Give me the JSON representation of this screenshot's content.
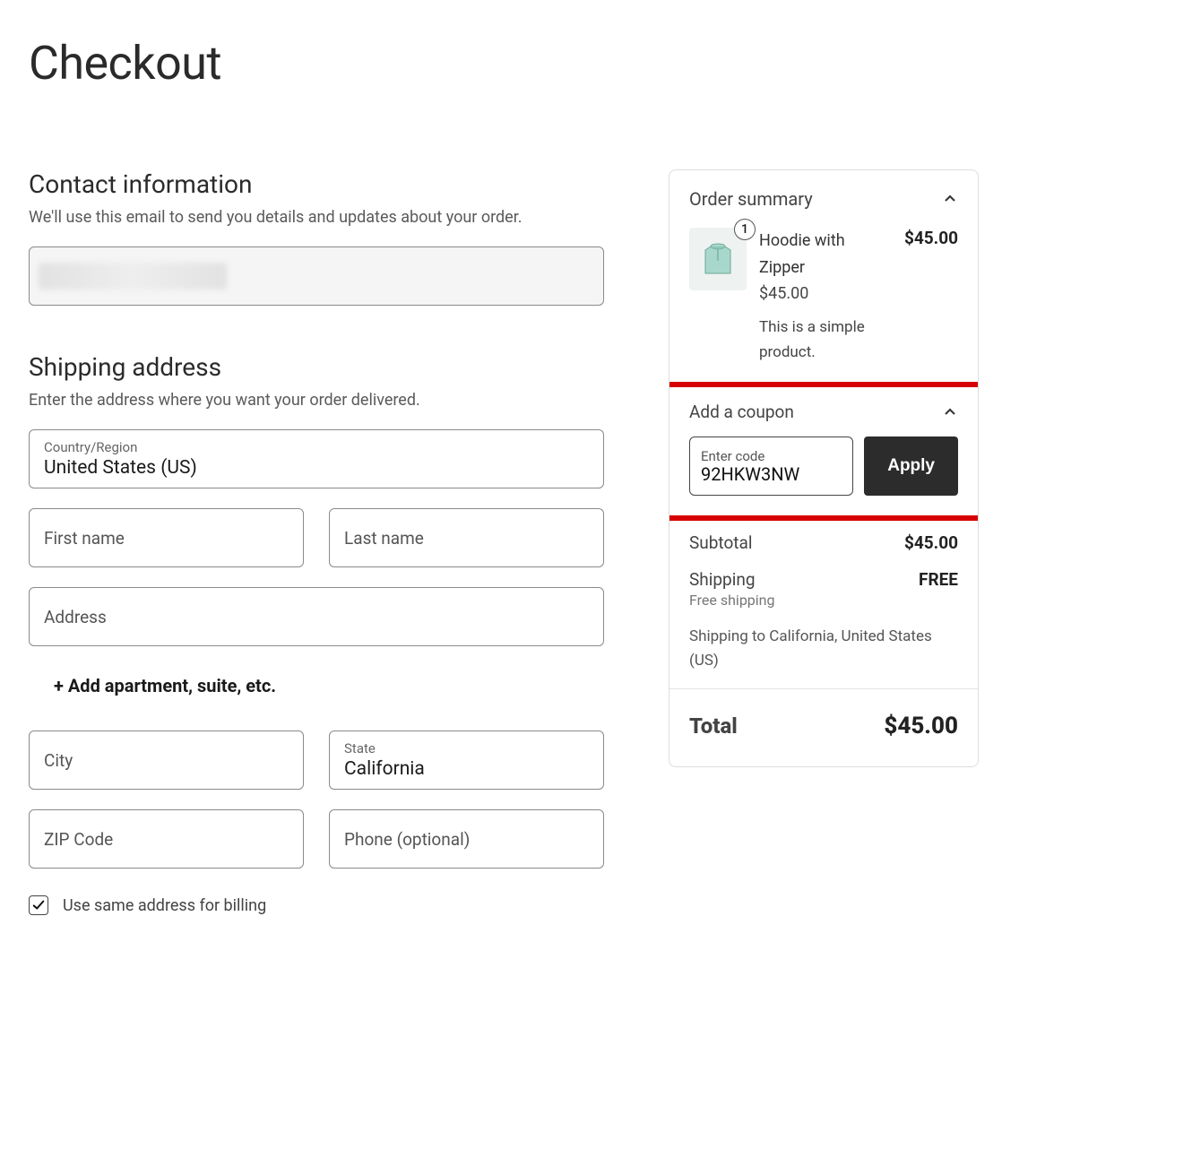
{
  "page_title": "Checkout",
  "contact": {
    "title": "Contact information",
    "desc": "We'll use this email to send you details and updates about your order.",
    "email_value": ""
  },
  "shipping": {
    "title": "Shipping address",
    "desc": "Enter the address where you want your order delivered.",
    "country_label": "Country/Region",
    "country_value": "United States (US)",
    "first_name_label": "First name",
    "last_name_label": "Last name",
    "address_label": "Address",
    "add_apartment": "+ Add apartment, suite, etc.",
    "city_label": "City",
    "state_label": "State",
    "state_value": "California",
    "zip_label": "ZIP Code",
    "phone_label": "Phone (optional)",
    "same_billing_label": "Use same address for billing",
    "same_billing_checked": true
  },
  "summary": {
    "title": "Order summary",
    "product": {
      "name": "Hoodie with Zipper",
      "qty": "1",
      "unit_price": "$45.00",
      "line_price": "$45.00",
      "desc": "This is a simple product."
    },
    "coupon": {
      "title": "Add a coupon",
      "input_label": "Enter code",
      "input_value": "92HKW3NW",
      "apply_label": "Apply"
    },
    "subtotal_label": "Subtotal",
    "subtotal_value": "$45.00",
    "shipping_label": "Shipping",
    "shipping_value": "FREE",
    "shipping_method": "Free shipping",
    "ship_to": "Shipping to California, United States (US)",
    "total_label": "Total",
    "total_value": "$45.00"
  }
}
